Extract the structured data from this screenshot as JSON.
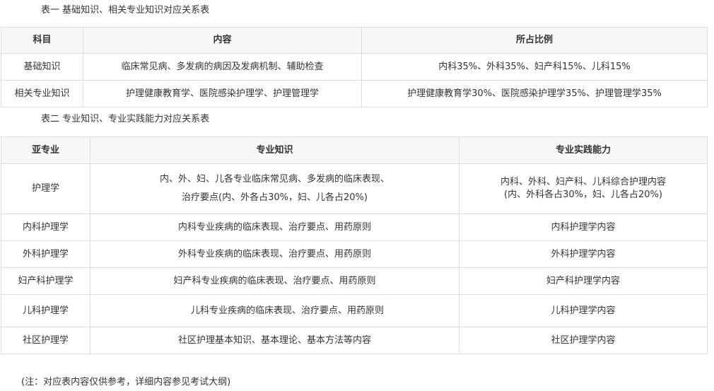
{
  "table1": {
    "caption": "表一 基础知识、相关专业知识对应关系表",
    "headers": [
      "科目",
      "内容",
      "所占比例"
    ],
    "rows": [
      [
        "基础知识",
        "临床常见病、多发病的病因及发病机制、辅助检查",
        "内科35%、外科35%、妇产科15%、儿科15%"
      ],
      [
        "相关专业知识",
        "护理健康教育学、医院感染护理学、护理管理学",
        "护理健康教育学30%、医院感染护理学35%、护理管理学35%"
      ]
    ]
  },
  "table2": {
    "caption": "表二 专业知识、专业实践能力对应关系表",
    "headers": [
      "亚专业",
      "专业知识",
      "专业实践能力"
    ],
    "rows": [
      {
        "name": "护理学",
        "knowledge": [
          "内、外、妇、儿各专业临床常见病、多发病的临床表现、",
          "治疗要点(内、外各占30%，妇、儿各占20%)"
        ],
        "practice": [
          "内科、外科、妇产科、儿科综合护理内容",
          "(内、外科各占30%，妇、儿各占20%)"
        ]
      },
      {
        "name": "内科护理学",
        "knowledge": "内科专业疾病的临床表现、治疗要点、用药原则",
        "practice": "内科护理学内容"
      },
      {
        "name": "外科护理学",
        "knowledge": "外科专业疾病的临床表现、治疗要点、用药原则",
        "practice": "外科护理学内容"
      },
      {
        "name": "妇产科护理学",
        "knowledge": "妇产科专业疾病的临床表现、治疗要点、用药原则",
        "practice": "妇产科护理学内容"
      },
      {
        "name": "儿科护理学",
        "knowledge": "儿科专业疾病的临床表现、治疗要点、用药原则",
        "practice": "儿科护理学内容"
      },
      {
        "name": "社区护理学",
        "knowledge": "社区护理基本知识、基本理论、基本方法等内容",
        "practice": "社区护理学内容"
      }
    ]
  },
  "note": "(注：对应表内容仅供参考，详细内容参见考试大纲)"
}
